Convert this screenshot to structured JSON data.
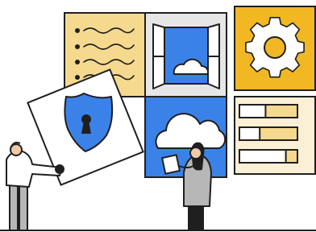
{
  "illustration": {
    "palette": {
      "outline": "#1f1f1f",
      "cream": "#f5d98e",
      "light_cream": "#fbf0d6",
      "blue": "#3b82e8",
      "gold": "#f2b824",
      "grey": "#e6e6e6",
      "white": "#ffffff",
      "skin": "#f0c9a8",
      "pants": "#b7b7b7"
    },
    "tiles": [
      {
        "name": "notes-tile",
        "icon": "handwriting-list-icon"
      },
      {
        "name": "window-tile",
        "icon": "open-window-icon"
      },
      {
        "name": "settings-tile",
        "icon": "gear-icon"
      },
      {
        "name": "cloud-tile",
        "icon": "cloud-icon"
      },
      {
        "name": "progress-tile",
        "icon": "progress-bars-icon",
        "bar_fills": [
          0.45,
          0.35,
          0.8
        ]
      }
    ],
    "held_card": {
      "icon": "shield-keyhole-icon"
    },
    "figures": [
      "person-left",
      "person-right"
    ]
  }
}
